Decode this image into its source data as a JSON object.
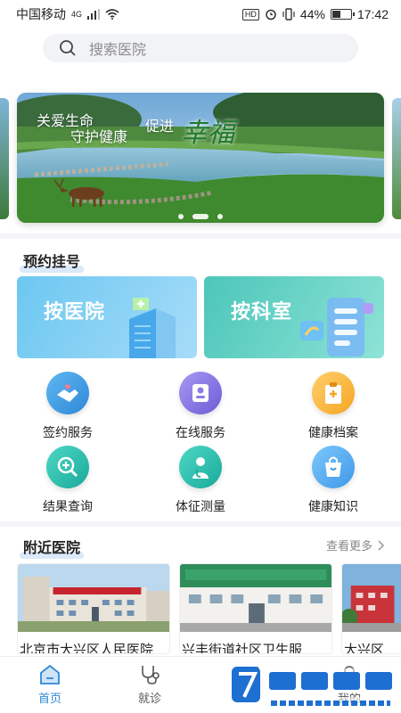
{
  "status_bar": {
    "carrier": "中国移动",
    "network": "4G",
    "hd_badge": "HD",
    "battery_percent": "44%",
    "battery_level": 0.44,
    "time": "17:42"
  },
  "search": {
    "placeholder": "搜索医院",
    "icon": "search-icon"
  },
  "banner": {
    "line1": "关爱生命",
    "line2": "守护健康",
    "line3": "促进",
    "big_text": "幸福",
    "slide_count": 3,
    "active_slide": 1
  },
  "appointment": {
    "title": "预约挂号",
    "cards": [
      {
        "label": "按医院",
        "icon": "hospital-building-icon"
      },
      {
        "label": "按科室",
        "icon": "department-list-icon"
      }
    ]
  },
  "services": [
    {
      "label": "签约服务",
      "icon": "handshake-icon"
    },
    {
      "label": "在线服务",
      "icon": "doctor-icon"
    },
    {
      "label": "健康档案",
      "icon": "clipboard-icon"
    },
    {
      "label": "结果查询",
      "icon": "magnify-plus-icon"
    },
    {
      "label": "体征测量",
      "icon": "stethoscope-doctor-icon"
    },
    {
      "label": "健康知识",
      "icon": "bag-icon"
    }
  ],
  "nearby": {
    "title": "附近医院",
    "see_more": "查看更多",
    "hospitals": [
      {
        "name": "北京市大兴区人民医院"
      },
      {
        "name": "兴丰街道社区卫生服"
      },
      {
        "name": "大兴区"
      }
    ]
  },
  "bottom_nav": {
    "items": [
      {
        "label": "首页",
        "icon": "home-icon",
        "active": true
      },
      {
        "label": "就诊",
        "icon": "stethoscope-icon",
        "active": false
      },
      {
        "label": "",
        "icon": "message-icon",
        "active": false
      },
      {
        "label": "我的",
        "icon": "user-icon",
        "active": false
      }
    ]
  },
  "colors": {
    "accent": "#2f88d6",
    "hospital_card": "#6cc7f1",
    "dept_card": "#4bc6b9"
  }
}
